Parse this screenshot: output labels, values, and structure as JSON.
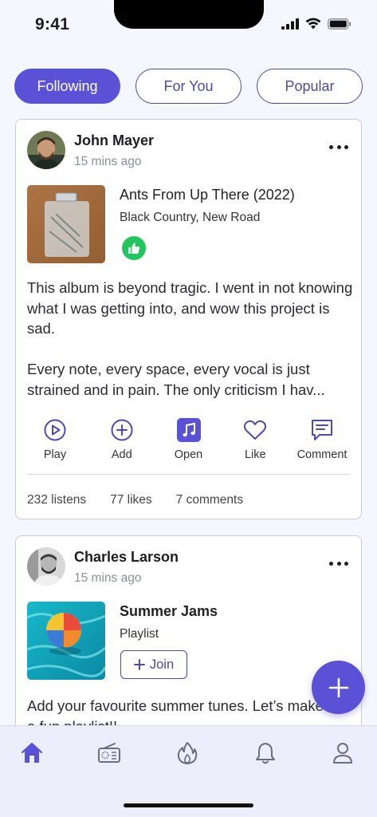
{
  "status_bar": {
    "time": "9:41"
  },
  "tabs": [
    {
      "label": "Following",
      "active": true
    },
    {
      "label": "For You",
      "active": false
    },
    {
      "label": "Popular",
      "active": false
    }
  ],
  "posts": [
    {
      "author": "John Mayer",
      "posted": "15 mins ago",
      "item_title": "Ants From Up There (2022)",
      "item_subtitle": "Black Country, New Road",
      "rating_icon": "thumbs-up-icon",
      "body_p1": "This album is beyond tragic. I went in not knowing what I was getting into, and wow this project is sad.",
      "body_p2": "Every note, every space, every vocal is just strained and in pain. The only criticism I hav...",
      "actions": [
        "Play",
        "Add",
        "Open",
        "Like",
        "Comment"
      ],
      "stats": {
        "listens": "232 listens",
        "likes": "77 likes",
        "comments": "7 comments"
      }
    },
    {
      "author": "Charles Larson",
      "posted": "15 mins ago",
      "item_title": "Summer Jams",
      "item_subtitle": "Playlist",
      "join_label": "Join",
      "body_p1": "Add your favourite summer tunes. Let’s make this a fun playlist!!"
    }
  ],
  "bottom_nav": [
    "home-icon",
    "radio-icon",
    "flame-icon",
    "bell-icon",
    "profile-icon"
  ],
  "colors": {
    "accent": "#5a51d6",
    "thumb": "#22c55e",
    "background": "#f5f7fe"
  }
}
